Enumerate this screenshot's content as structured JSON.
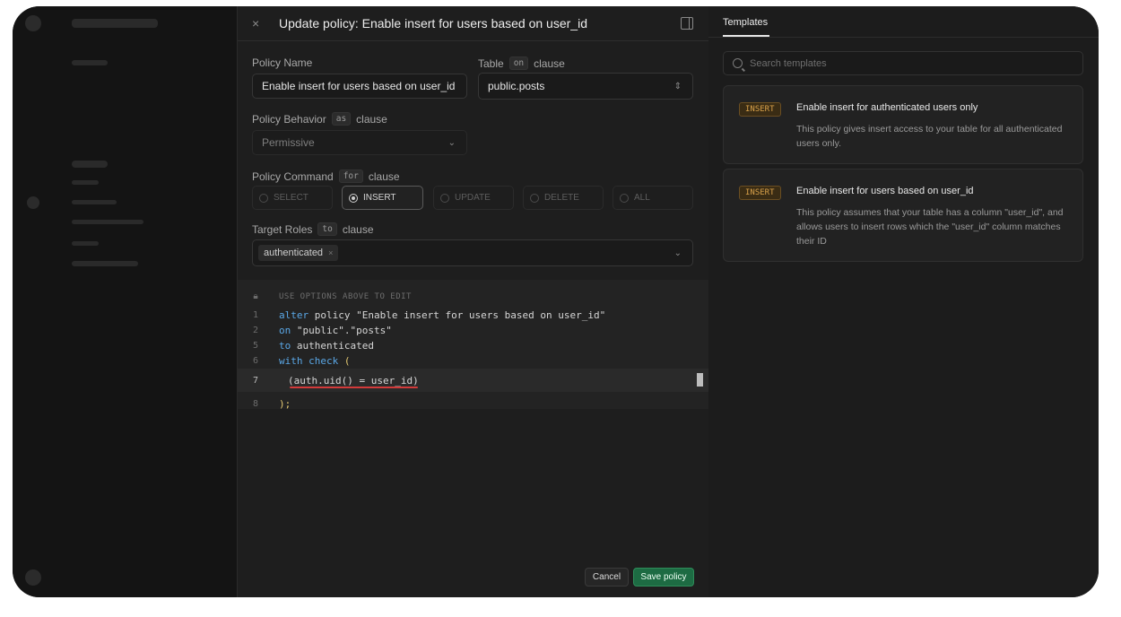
{
  "modal": {
    "title": "Update policy: Enable insert for users based on user_id",
    "close_icon": "close-icon",
    "panel_icon": "panel-toggle-icon"
  },
  "form": {
    "policy_name_label": "Policy Name",
    "policy_name_value": "Enable insert for users based on user_id",
    "table_label": "Table",
    "table_kw": "on",
    "table_clause": "clause",
    "table_value": "public.posts",
    "behavior_label": "Policy Behavior",
    "behavior_kw": "as",
    "behavior_clause": "clause",
    "behavior_value": "Permissive",
    "command_label": "Policy Command",
    "command_kw": "for",
    "command_clause": "clause",
    "commands": [
      "SELECT",
      "INSERT",
      "UPDATE",
      "DELETE",
      "ALL"
    ],
    "selected_command": "INSERT",
    "roles_label": "Target Roles",
    "roles_kw": "to",
    "roles_clause": "clause",
    "roles_value": "authenticated",
    "roles_remove": "×"
  },
  "code": {
    "hint": "USE OPTIONS ABOVE TO EDIT",
    "lines": [
      {
        "num": "1",
        "kw": "alter",
        "rest": " policy \"Enable insert for users based on user_id\""
      },
      {
        "num": "2",
        "kw": "on",
        "rest": " \"public\".\"posts\""
      },
      {
        "num": "5",
        "kw": "to",
        "rest": " authenticated"
      },
      {
        "num": "6",
        "kw": "with check",
        "rest": " ("
      },
      {
        "num": "7",
        "text": "(auth.uid() = user_id)"
      },
      {
        "num": "8",
        "text": ");"
      }
    ]
  },
  "actions": {
    "cancel": "Cancel",
    "save": "Save policy"
  },
  "templates": {
    "tab": "Templates",
    "search_placeholder": "Search templates",
    "items": [
      {
        "badge": "INSERT",
        "title": "Enable insert for authenticated users only",
        "desc": "This policy gives insert access to your table for all authenticated users only."
      },
      {
        "badge": "INSERT",
        "title": "Enable insert for users based on user_id",
        "desc": "This policy assumes that your table has a column \"user_id\", and allows users to insert rows which the \"user_id\" column matches their ID"
      }
    ]
  },
  "colors": {
    "accent_green": "#1d6b43",
    "badge_amber": "#d8a14a",
    "keyword_blue": "#5aa7e6",
    "error_red": "#d33a3a"
  }
}
